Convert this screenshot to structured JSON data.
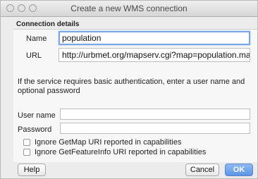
{
  "window": {
    "title": "Create a new WMS connection"
  },
  "group": {
    "label": "Connection details"
  },
  "fields": {
    "name_label": "Name",
    "name_value": "population",
    "url_label": "URL",
    "url_value": "http://urbmet.org/mapserv.cgi?map=population.map",
    "info_text": "If the service requires basic authentication, enter a user name and optional password",
    "username_label": "User name",
    "username_value": "",
    "password_label": "Password",
    "password_value": ""
  },
  "checkboxes": [
    {
      "label": "Ignore GetMap URI reported in capabilities",
      "checked": false
    },
    {
      "label": "Ignore GetFeatureInfo URI reported in capabilities",
      "checked": false
    }
  ],
  "buttons": {
    "help": "Help",
    "cancel": "Cancel",
    "ok": "OK"
  }
}
